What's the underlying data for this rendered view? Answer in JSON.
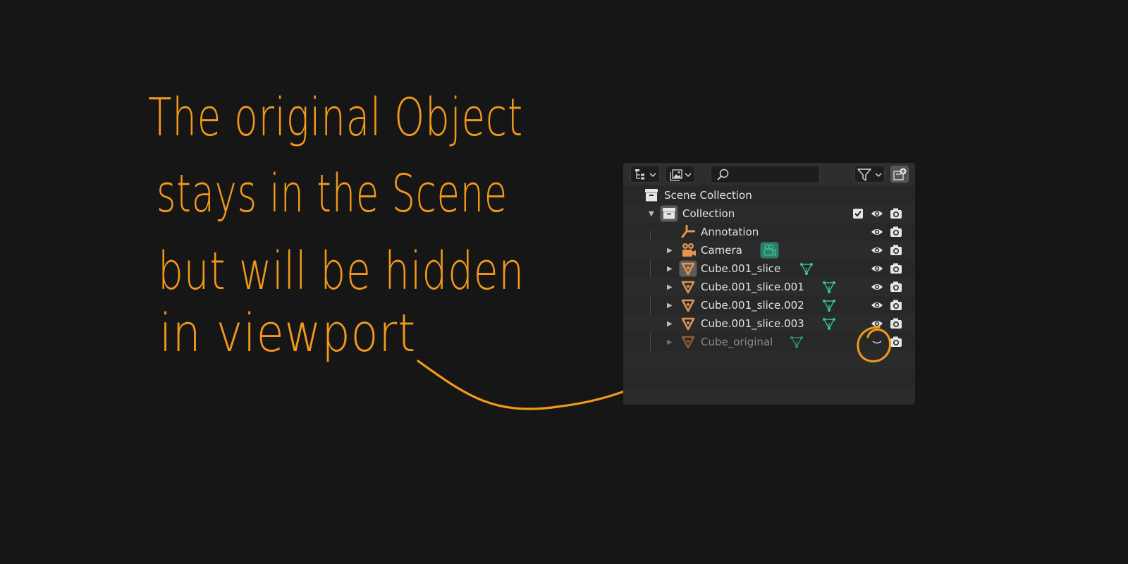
{
  "note": {
    "lines": [
      "The original Object",
      "stays in the Scene",
      "but will be hidden",
      "in viewport"
    ]
  },
  "outliner": {
    "search": {
      "value": ""
    },
    "scene_collection": "Scene Collection",
    "collection": "Collection",
    "items": [
      {
        "label": "Annotation",
        "icon": "annotation-icon"
      },
      {
        "label": "Camera",
        "icon": "camera-object-icon"
      },
      {
        "label": "Cube.001_slice",
        "icon": "mesh-object-icon"
      },
      {
        "label": "Cube.001_slice.001",
        "icon": "mesh-object-icon"
      },
      {
        "label": "Cube.001_slice.002",
        "icon": "mesh-object-icon"
      },
      {
        "label": "Cube.001_slice.003",
        "icon": "mesh-object-icon"
      },
      {
        "label": "Cube_original",
        "icon": "mesh-object-icon",
        "hidden_in_viewport": true
      }
    ]
  },
  "colors": {
    "annotation": "#f2991c",
    "object_icon": "#e3944e",
    "mesh_data": "#35c49a",
    "background": "#161616",
    "panel": "#282828"
  }
}
